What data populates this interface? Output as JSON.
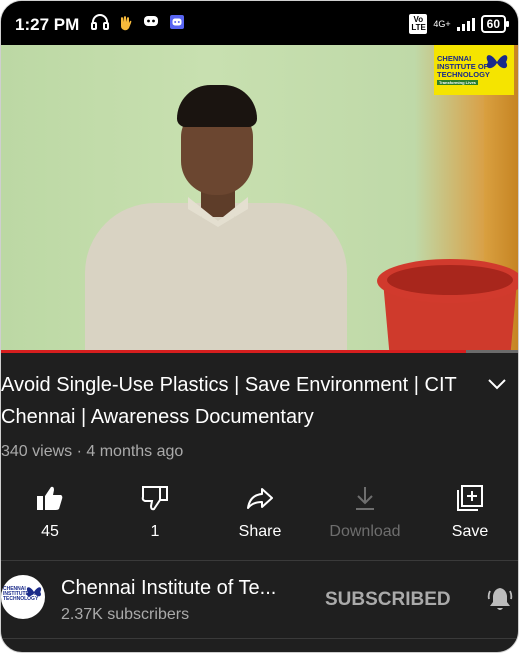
{
  "status_bar": {
    "time": "1:27 PM",
    "icons": [
      "headphones-icon",
      "waving-hand-icon",
      "discord-icon",
      "discord-icon"
    ],
    "volte": "Vo LTE",
    "network": "4G+",
    "battery": "60"
  },
  "video": {
    "watermark_lines": [
      "CHENNAI",
      "INSTITUTE OF",
      "TECHNOLOGY"
    ],
    "watermark_tagline": "Transforming Lives",
    "progress": 0.9
  },
  "details": {
    "title": "Avoid Single-Use Plastics | Save Environment | CIT Chennai | Awareness Documentary",
    "meta": "340 views · 4 months ago"
  },
  "actions": [
    {
      "label": "45",
      "icon": "thumbs-up-filled-icon"
    },
    {
      "label": "1",
      "icon": "thumbs-down-icon"
    },
    {
      "label": "Share",
      "icon": "share-icon"
    },
    {
      "label": "Download",
      "icon": "download-icon"
    },
    {
      "label": "Save",
      "icon": "save-to-playlist-icon"
    }
  ],
  "channel": {
    "name": "Chennai Institute of Te...",
    "subscribers": "2.37K subscribers",
    "subscribe_state": "SUBSCRIBED"
  },
  "colors": {
    "background": "#1f1f1f",
    "progress": "#d61e1e",
    "logo_yellow": "#f5e400"
  }
}
